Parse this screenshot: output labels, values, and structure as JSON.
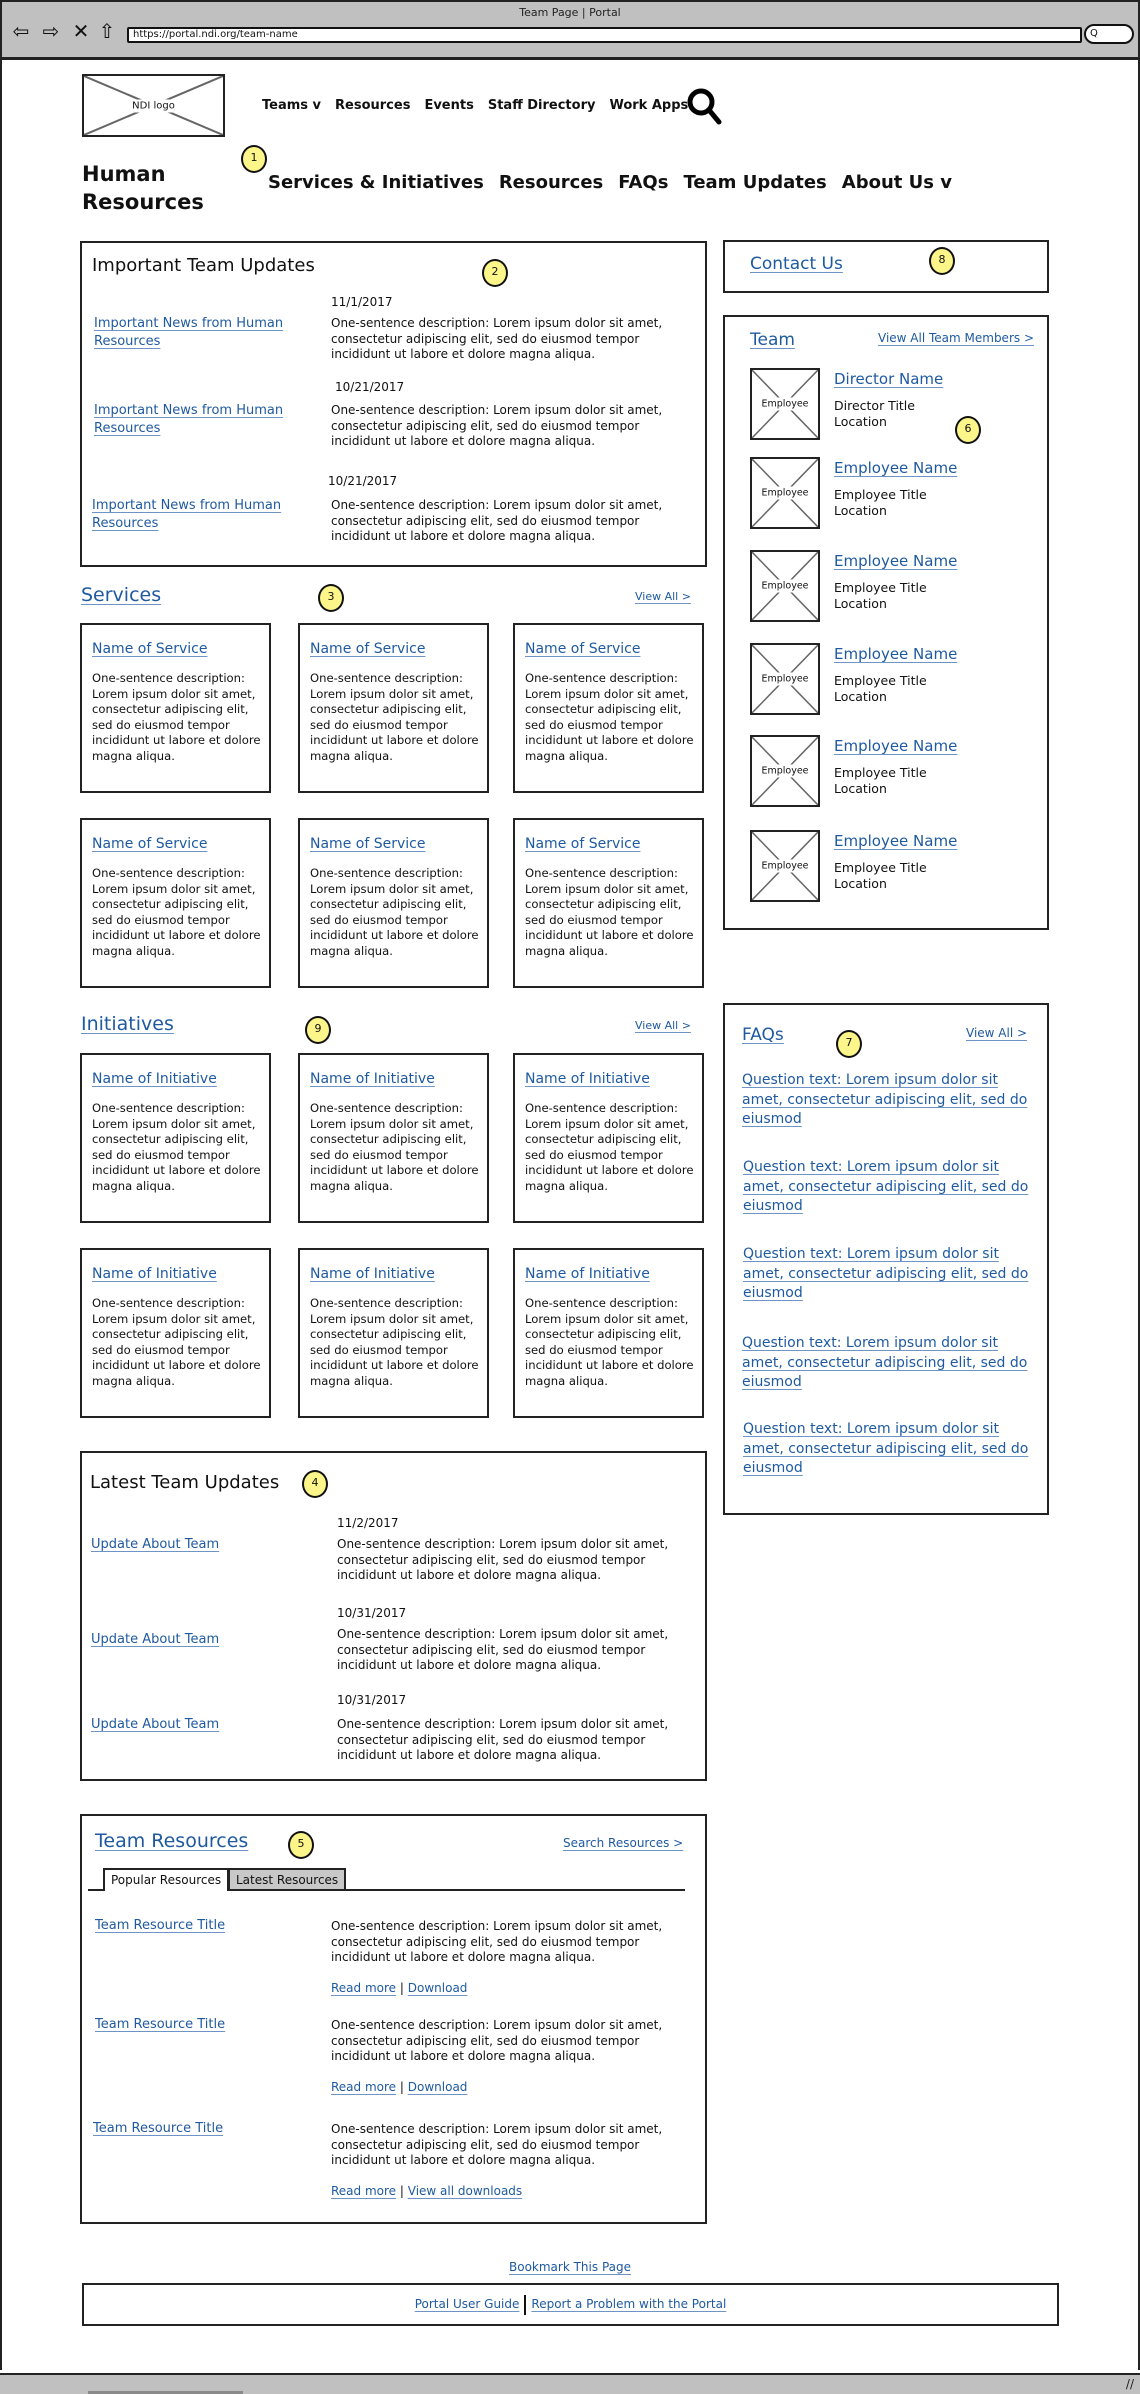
{
  "browser": {
    "window_title": "Team Page | Portal",
    "url": "https://portal.ndi.org/team-name",
    "search_glyph": "Q"
  },
  "header": {
    "logo_label": "NDI logo",
    "top_nav": [
      "Teams v",
      "Resources",
      "Events",
      "Staff Directory",
      "Work Apps"
    ],
    "site_title_line1": "Human",
    "site_title_line2": "Resources",
    "sub_nav": [
      "Services & Initiatives",
      "Resources",
      "FAQs",
      "Team Updates",
      "About Us v"
    ]
  },
  "badges": [
    "1",
    "2",
    "3",
    "4",
    "5",
    "6",
    "7",
    "8",
    "9"
  ],
  "important_updates": {
    "title": "Important Team Updates",
    "items": [
      {
        "date": "11/1/2017",
        "link": "Important News from Human Resources",
        "desc": "One-sentence description: Lorem ipsum dolor sit amet, consectetur adipiscing elit, sed do eiusmod tempor incididunt ut labore et dolore magna aliqua."
      },
      {
        "date": "10/21/2017",
        "link": "Important News from Human Resources",
        "desc": "One-sentence description: Lorem ipsum dolor sit amet, consectetur adipiscing elit, sed do eiusmod tempor incididunt ut labore et dolore magna aliqua."
      },
      {
        "date": "10/21/2017",
        "link": "Important News from Human Resources",
        "desc": "One-sentence description: Lorem ipsum dolor sit amet, consectetur adipiscing elit, sed do eiusmod tempor incididunt ut labore et dolore magna aliqua."
      }
    ]
  },
  "services": {
    "title": "Services",
    "view_all": "View All >",
    "cards": [
      {
        "name": "Name of Service",
        "desc": "One-sentence description: Lorem ipsum dolor sit amet, consectetur adipiscing elit, sed do eiusmod tempor incididunt ut labore et dolore magna aliqua."
      },
      {
        "name": "Name of Service",
        "desc": "One-sentence description: Lorem ipsum dolor sit amet, consectetur adipiscing elit, sed do eiusmod tempor incididunt ut labore et dolore magna aliqua."
      },
      {
        "name": "Name of Service",
        "desc": "One-sentence description: Lorem ipsum dolor sit amet, consectetur adipiscing elit, sed do eiusmod tempor incididunt ut labore et dolore magna aliqua."
      },
      {
        "name": "Name of Service",
        "desc": "One-sentence description: Lorem ipsum dolor sit amet, consectetur adipiscing elit, sed do eiusmod tempor incididunt ut labore et dolore magna aliqua."
      },
      {
        "name": "Name of Service",
        "desc": "One-sentence description: Lorem ipsum dolor sit amet, consectetur adipiscing elit, sed do eiusmod tempor incididunt ut labore et dolore magna aliqua."
      },
      {
        "name": "Name of Service",
        "desc": "One-sentence description: Lorem ipsum dolor sit amet, consectetur adipiscing elit, sed do eiusmod tempor incididunt ut labore et dolore magna aliqua."
      }
    ]
  },
  "initiatives": {
    "title": "Initiatives",
    "view_all": "View All >",
    "cards": [
      {
        "name": "Name of Initiative",
        "desc": "One-sentence description: Lorem ipsum dolor sit amet, consectetur adipiscing elit, sed do eiusmod tempor incididunt ut labore et dolore magna aliqua."
      },
      {
        "name": "Name of Initiative",
        "desc": "One-sentence description: Lorem ipsum dolor sit amet, consectetur adipiscing elit, sed do eiusmod tempor incididunt ut labore et dolore magna aliqua."
      },
      {
        "name": "Name of Initiative",
        "desc": "One-sentence description: Lorem ipsum dolor sit amet, consectetur adipiscing elit, sed do eiusmod tempor incididunt ut labore et dolore magna aliqua."
      },
      {
        "name": "Name of Initiative",
        "desc": "One-sentence description: Lorem ipsum dolor sit amet, consectetur adipiscing elit, sed do eiusmod tempor incididunt ut labore et dolore magna aliqua."
      },
      {
        "name": "Name of Initiative",
        "desc": "One-sentence description: Lorem ipsum dolor sit amet, consectetur adipiscing elit, sed do eiusmod tempor incididunt ut labore et dolore magna aliqua."
      },
      {
        "name": "Name of Initiative",
        "desc": "One-sentence description: Lorem ipsum dolor sit amet, consectetur adipiscing elit, sed do eiusmod tempor incididunt ut labore et dolore magna aliqua."
      }
    ]
  },
  "latest_updates": {
    "title": "Latest Team Updates",
    "items": [
      {
        "date": "11/2/2017",
        "link": "Update About Team",
        "desc": "One-sentence description: Lorem ipsum dolor sit amet, consectetur adipiscing elit, sed do eiusmod tempor incididunt ut labore et dolore magna aliqua."
      },
      {
        "date": "10/31/2017",
        "link": "Update About Team",
        "desc": "One-sentence description: Lorem ipsum dolor sit amet, consectetur adipiscing elit, sed do eiusmod tempor incididunt ut labore et dolore magna aliqua."
      },
      {
        "date": "10/31/2017",
        "link": "Update About Team",
        "desc": "One-sentence description: Lorem ipsum dolor sit amet, consectetur adipiscing elit, sed do eiusmod tempor incididunt ut labore et dolore magna aliqua."
      }
    ]
  },
  "resources": {
    "title": "Team Resources",
    "search_link": "Search Resources >",
    "tabs": [
      "Popular Resources",
      "Latest Resources"
    ],
    "active_tab": "Popular Resources",
    "items": [
      {
        "title": "Team Resource Title",
        "desc": "One-sentence description: Lorem ipsum dolor sit amet, consectetur adipiscing elit, sed do eiusmod tempor incididunt ut labore et dolore magna aliqua.",
        "action1": "Read more",
        "sep": "|",
        "action2": "Download"
      },
      {
        "title": "Team Resource Title",
        "desc": "One-sentence description: Lorem ipsum dolor sit amet, consectetur adipiscing elit, sed do eiusmod tempor incididunt ut labore et dolore magna aliqua.",
        "action1": "Read more",
        "sep": "|",
        "action2": "Download"
      },
      {
        "title": "Team Resource Title",
        "desc": "One-sentence description: Lorem ipsum dolor sit amet, consectetur adipiscing elit, sed do eiusmod tempor incididunt ut labore et dolore magna aliqua.",
        "action1": "Read more",
        "sep": "|",
        "action2": "View all downloads"
      }
    ]
  },
  "contact": {
    "label": "Contact Us"
  },
  "team": {
    "title": "Team",
    "view_all": "View All Team Members >",
    "photo_label": "Employee",
    "members": [
      {
        "name": "Director Name",
        "title": "Director Title",
        "location": "Location"
      },
      {
        "name": "Employee Name",
        "title": "Employee Title",
        "location": "Location"
      },
      {
        "name": "Employee Name",
        "title": "Employee Title",
        "location": "Location"
      },
      {
        "name": "Employee Name",
        "title": "Employee Title",
        "location": "Location"
      },
      {
        "name": "Employee Name",
        "title": "Employee Title",
        "location": "Location"
      },
      {
        "name": "Employee Name",
        "title": "Employee Title",
        "location": "Location"
      }
    ]
  },
  "faqs": {
    "title": "FAQs",
    "view_all": "View All >",
    "questions": [
      "Question text: Lorem ipsum dolor sit amet, consectetur adipiscing elit, sed do eiusmod",
      "Question text: Lorem ipsum dolor sit amet, consectetur adipiscing elit, sed do eiusmod",
      "Question text: Lorem ipsum dolor sit amet, consectetur adipiscing elit, sed do eiusmod",
      "Question text: Lorem ipsum dolor sit amet, consectetur adipiscing elit, sed do eiusmod",
      "Question text: Lorem ipsum dolor sit amet, consectetur adipiscing elit, sed do eiusmod"
    ]
  },
  "footer": {
    "bookmark": "Bookmark This Page",
    "links": [
      "Portal User Guide",
      "Report a Problem with the Portal"
    ]
  },
  "colors": {
    "link": "#1f5aa0",
    "badge": "#fbf58a",
    "chrome": "#c0c0c0"
  }
}
